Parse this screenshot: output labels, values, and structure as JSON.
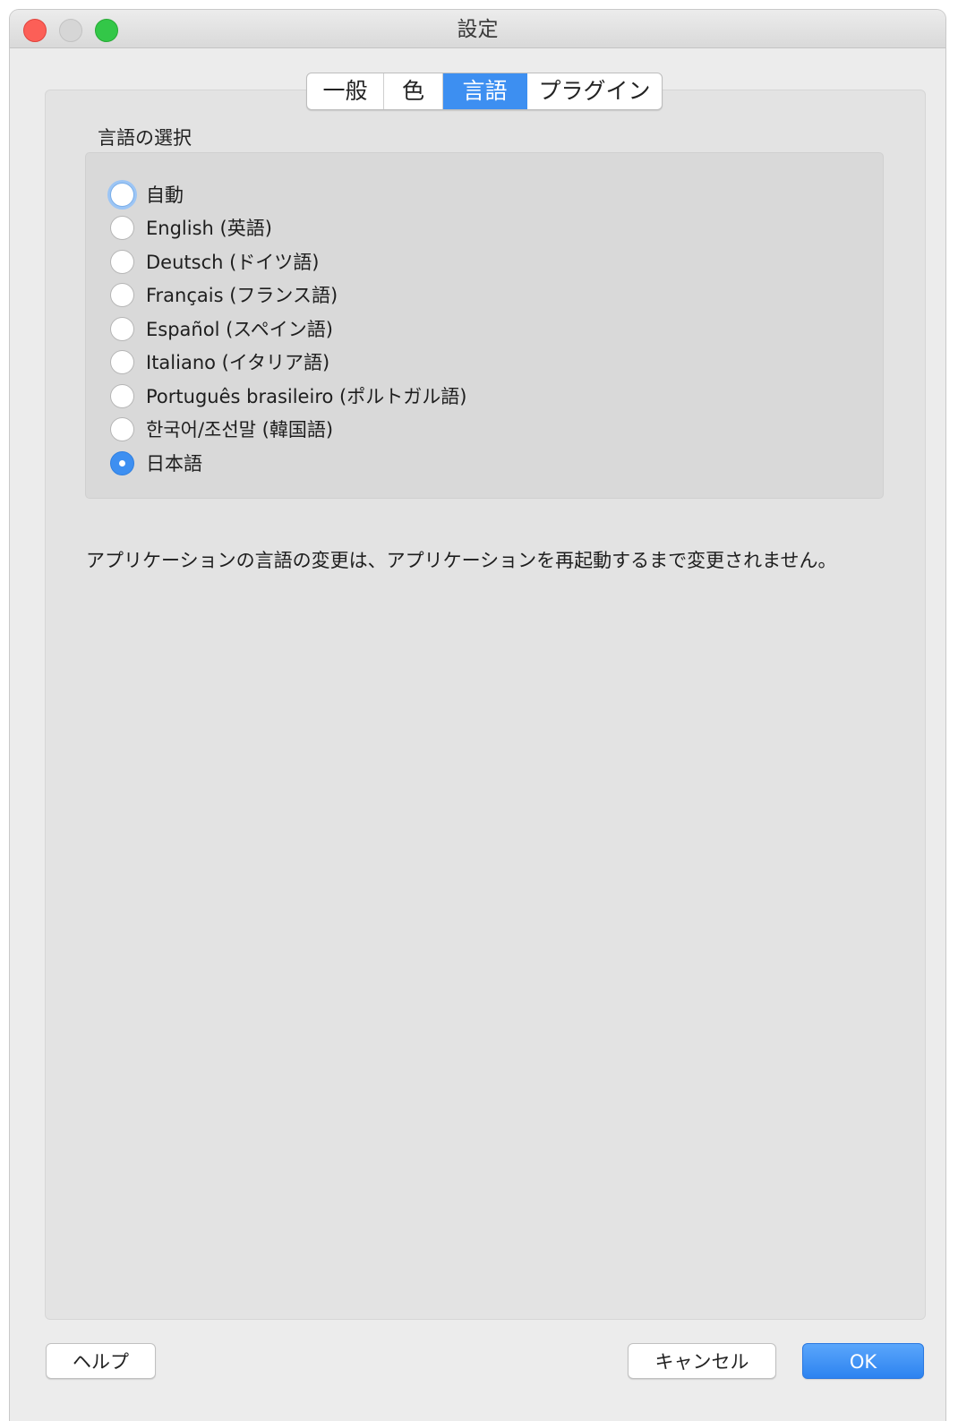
{
  "window": {
    "title": "設定",
    "accent_color": "#3d8ff1",
    "traffic_lights": [
      "close",
      "minimize",
      "zoom"
    ]
  },
  "tabs": [
    {
      "label": "一般",
      "active": false
    },
    {
      "label": "色",
      "active": false
    },
    {
      "label": "言語",
      "active": true
    },
    {
      "label": "プラグイン",
      "active": false
    }
  ],
  "language": {
    "section_label": "言語の選択",
    "options": [
      {
        "label": "自動",
        "checked": false,
        "focused": true
      },
      {
        "label": "English (英語)",
        "checked": false
      },
      {
        "label": "Deutsch (ドイツ語)",
        "checked": false
      },
      {
        "label": "Français (フランス語)",
        "checked": false
      },
      {
        "label": "Español (スペイン語)",
        "checked": false
      },
      {
        "label": "Italiano (イタリア語)",
        "checked": false
      },
      {
        "label": "Português brasileiro (ポルトガル語)",
        "checked": false
      },
      {
        "label": "한국어/조선말 (韓国語)",
        "checked": false
      },
      {
        "label": "日本語",
        "checked": true
      }
    ],
    "note": "アプリケーションの言語の変更は、アプリケーションを再起動するまで変更されません。"
  },
  "buttons": {
    "help": "ヘルプ",
    "cancel": "キャンセル",
    "ok": "OK"
  }
}
